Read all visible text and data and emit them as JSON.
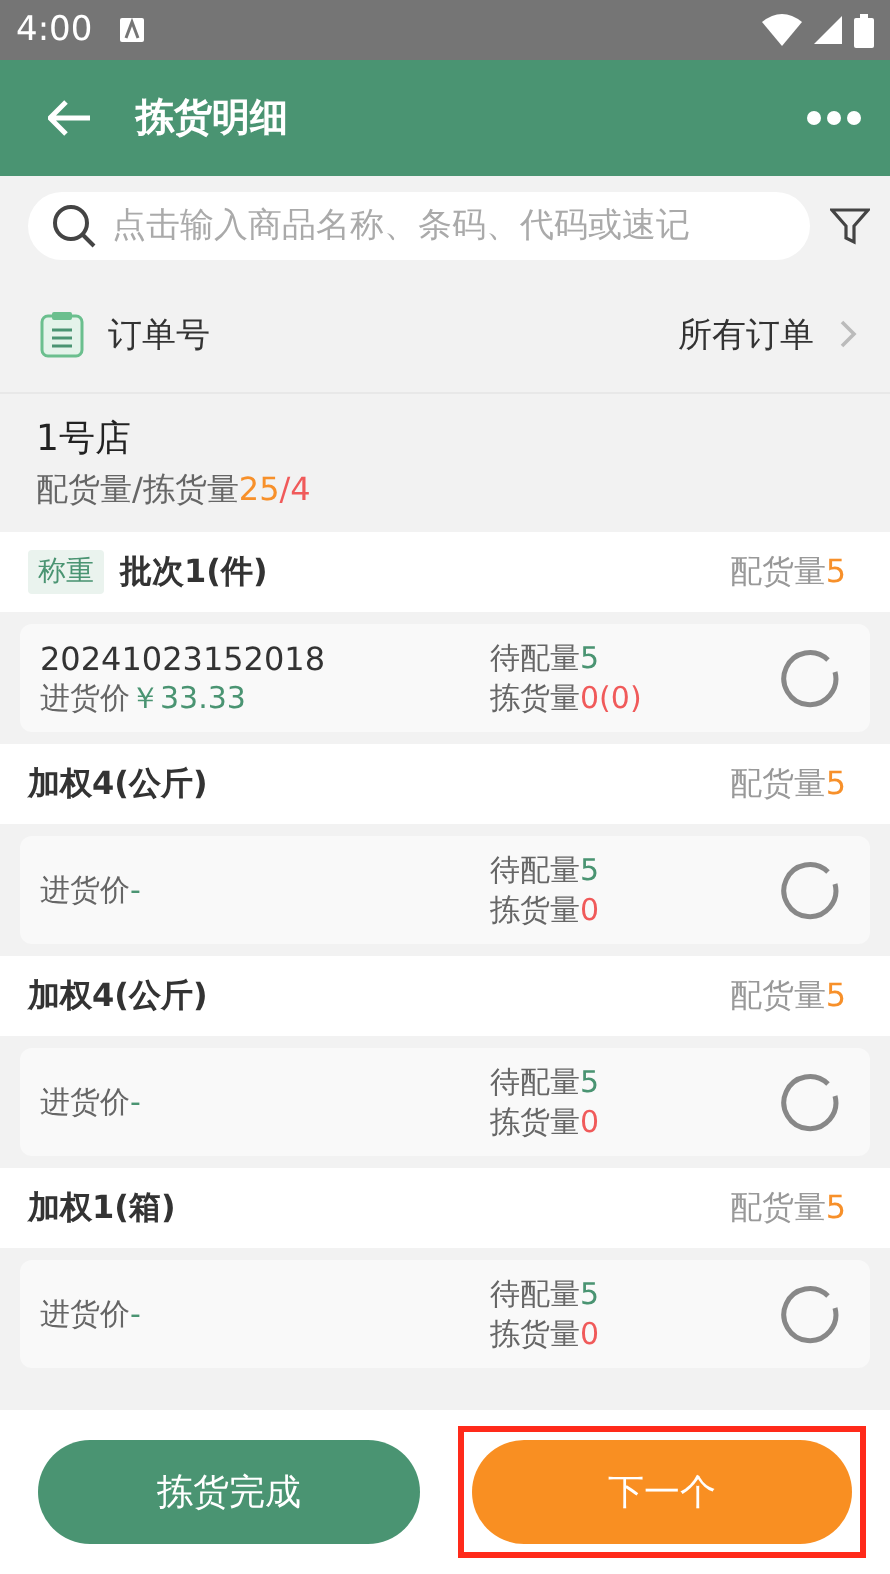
{
  "status_bar": {
    "time": "4:00"
  },
  "app_bar": {
    "title": "拣货明细"
  },
  "search": {
    "placeholder": "点击输入商品名称、条码、代码或速记"
  },
  "order_row": {
    "label": "订单号",
    "value": "所有订单"
  },
  "store": {
    "name": "1号店",
    "summary_label": "配货量/拣货量",
    "allocated": "25",
    "separator": "/",
    "picked": "4"
  },
  "groups": [
    {
      "tag": "称重",
      "name": "批次1(件)",
      "qty_label": "配货量",
      "qty": "5",
      "card": {
        "code": "20241023152018",
        "price_label": "进货价",
        "price": "￥33.33",
        "pending_label": "待配量",
        "pending": "5",
        "picked_label": "拣货量",
        "picked": "0(0)"
      }
    },
    {
      "name": "加权4(公斤)",
      "qty_label": "配货量",
      "qty": "5",
      "card": {
        "price_label": "进货价",
        "price": "-",
        "pending_label": "待配量",
        "pending": "5",
        "picked_label": "拣货量",
        "picked": "0"
      }
    },
    {
      "name": "加权4(公斤)",
      "qty_label": "配货量",
      "qty": "5",
      "card": {
        "price_label": "进货价",
        "price": "-",
        "pending_label": "待配量",
        "pending": "5",
        "picked_label": "拣货量",
        "picked": "0"
      }
    },
    {
      "name": "加权1(箱)",
      "qty_label": "配货量",
      "qty": "5",
      "card": {
        "price_label": "进货价",
        "price": "-",
        "pending_label": "待配量",
        "pending": "5",
        "picked_label": "拣货量",
        "picked": "0"
      }
    }
  ],
  "buttons": [
    {
      "label": "拣货完成",
      "kind": "secondary",
      "highlighted": false
    },
    {
      "label": "下一个",
      "kind": "primary",
      "highlighted": true
    }
  ]
}
